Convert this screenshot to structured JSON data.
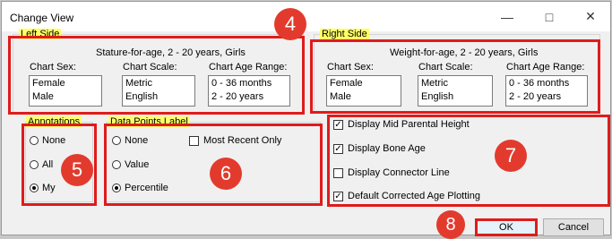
{
  "window": {
    "title": "Change View"
  },
  "left_side": {
    "legend": "Left Side",
    "chart_title": "Stature-for-age, 2 - 20 years, Girls",
    "sex_label": "Chart Sex:",
    "scale_label": "Chart Scale:",
    "range_label": "Chart Age Range:",
    "sex_options": [
      "Female",
      "Male"
    ],
    "scale_options": [
      "Metric",
      "English"
    ],
    "range_options": [
      "0 - 36 months",
      "2 - 20 years"
    ],
    "selected_range": "2 - 20 years"
  },
  "right_side": {
    "legend": "Right Side",
    "chart_title": "Weight-for-age, 2 - 20 years, Girls",
    "sex_label": "Chart Sex:",
    "scale_label": "Chart Scale:",
    "range_label": "Chart Age Range:",
    "sex_options": [
      "Female",
      "Male"
    ],
    "scale_options": [
      "Metric",
      "English"
    ],
    "range_options": [
      "0 - 36 months",
      "2 - 20 years"
    ],
    "selected_range": "2 - 20 years"
  },
  "annotations": {
    "legend": "Annotations",
    "options": [
      "None",
      "All",
      "My"
    ],
    "selected": "My"
  },
  "data_points": {
    "legend": "Data Points Label",
    "options": [
      "None",
      "Value",
      "Percentile"
    ],
    "selected": "Percentile",
    "most_recent_label": "Most Recent Only",
    "most_recent_checked": false
  },
  "display_options": [
    {
      "label": "Display Mid Parental Height",
      "checked": true
    },
    {
      "label": "Display Bone Age",
      "checked": true
    },
    {
      "label": "Display Connector Line",
      "checked": false
    },
    {
      "label": "Default Corrected Age Plotting",
      "checked": true
    }
  ],
  "buttons": {
    "ok": "OK",
    "cancel": "Cancel"
  },
  "callouts": {
    "n4": "4",
    "n5": "5",
    "n6": "6",
    "n7": "7",
    "n8": "8"
  },
  "colors": {
    "highlight": "#ffff66",
    "callout_red": "#e01b1b"
  }
}
